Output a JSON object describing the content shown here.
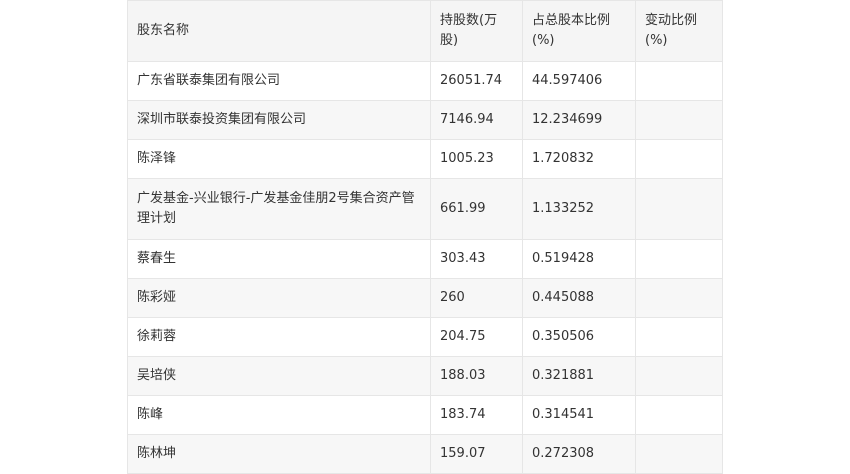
{
  "table": {
    "headers": [
      "股东名称",
      "持股数(万股)",
      "占总股本比例(%)",
      "变动比例(%)"
    ],
    "rows": [
      [
        "广东省联泰集团有限公司",
        "26051.74",
        "44.597406",
        ""
      ],
      [
        "深圳市联泰投资集团有限公司",
        "7146.94",
        "12.234699",
        ""
      ],
      [
        "陈泽锋",
        "1005.23",
        "1.720832",
        ""
      ],
      [
        "广发基金-兴业银行-广发基金佳朋2号集合资产管理计划",
        "661.99",
        "1.133252",
        ""
      ],
      [
        "蔡春生",
        "303.43",
        "0.519428",
        ""
      ],
      [
        "陈彩娅",
        "260",
        "0.445088",
        ""
      ],
      [
        "徐莉蓉",
        "204.75",
        "0.350506",
        ""
      ],
      [
        "吴培侠",
        "188.03",
        "0.321881",
        ""
      ],
      [
        "陈峰",
        "183.74",
        "0.314541",
        ""
      ],
      [
        "陈林坤",
        "159.07",
        "0.272308",
        ""
      ]
    ]
  }
}
